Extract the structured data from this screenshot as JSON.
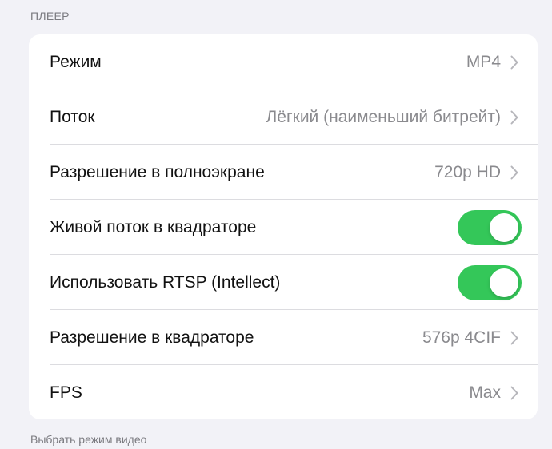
{
  "player": {
    "section_title": "ПЛЕЕР",
    "rows": [
      {
        "label": "Режим",
        "value": "MP4",
        "control": "chevron"
      },
      {
        "label": "Поток",
        "value": "Лёгкий (наименьший битрейт)",
        "control": "chevron"
      },
      {
        "label": "Разрешение в полноэкране",
        "value": "720p HD",
        "control": "chevron"
      },
      {
        "label": "Живой поток в квадраторе",
        "toggle_on": true,
        "control": "toggle"
      },
      {
        "label": "Использовать RTSP (Intellect)",
        "toggle_on": true,
        "control": "toggle"
      },
      {
        "label": "Разрешение в квадраторе",
        "value": "576p 4CIF",
        "control": "chevron"
      },
      {
        "label": "FPS",
        "value": "Max",
        "control": "chevron"
      }
    ]
  },
  "footer_text": "Выбрать режим видео",
  "colors": {
    "background": "#f2f2f7",
    "card": "#ffffff",
    "toggle_on": "#34c759",
    "secondary_text": "#8a8a8e"
  },
  "icons": {
    "chevron": "chevron-right-icon"
  }
}
